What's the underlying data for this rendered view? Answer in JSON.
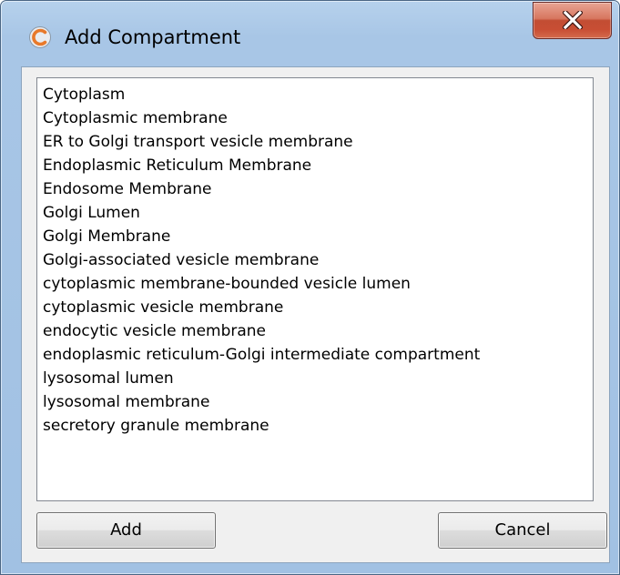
{
  "window": {
    "title": "Add Compartment",
    "icon": "app-c-icon",
    "close_icon": "close-x-icon"
  },
  "compartments": [
    "Cytoplasm",
    "Cytoplasmic membrane",
    "ER to Golgi transport vesicle membrane",
    "Endoplasmic Reticulum Membrane",
    "Endosome Membrane",
    "Golgi Lumen",
    "Golgi Membrane",
    "Golgi-associated vesicle membrane",
    "cytoplasmic membrane-bounded vesicle lumen",
    "cytoplasmic vesicle membrane",
    "endocytic vesicle membrane",
    "endoplasmic reticulum-Golgi intermediate compartment",
    "lysosomal lumen",
    "lysosomal membrane",
    "secretory granule membrane"
  ],
  "buttons": {
    "add_label": "Add",
    "cancel_label": "Cancel"
  },
  "colors": {
    "frame": "#a8c6e6",
    "close_button": "#c84e34",
    "dialog_background": "#f0f0f0"
  }
}
